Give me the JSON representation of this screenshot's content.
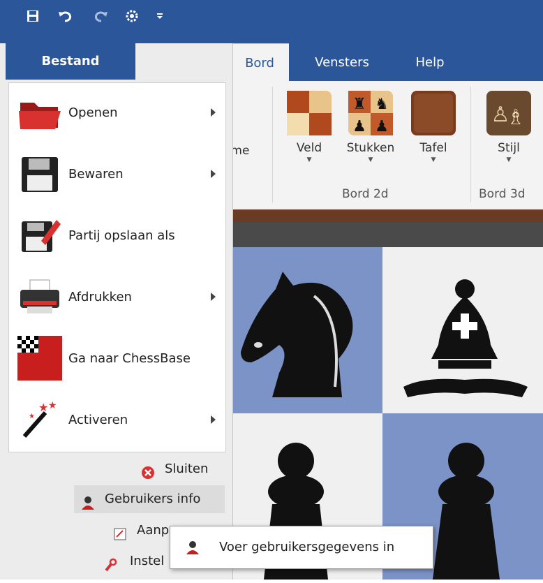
{
  "titlebar": {
    "quick_access": [
      "save-icon",
      "undo-icon",
      "redo-icon",
      "engine-icon",
      "customize-dropdown-icon"
    ]
  },
  "tabs": [
    {
      "label": "Bord",
      "active": true
    },
    {
      "label": "Vensters",
      "active": false
    },
    {
      "label": "Help",
      "active": false
    }
  ],
  "ribbon": {
    "partial_label": "ame",
    "buttons": [
      {
        "label": "Veld",
        "icon": "board-squares-icon"
      },
      {
        "label": "Stukken",
        "icon": "chess-pieces-icon"
      },
      {
        "label": "Tafel",
        "icon": "table-wood-icon"
      },
      {
        "label": "Stijl",
        "icon": "3d-style-icon"
      }
    ],
    "groups": [
      "Bord 2d",
      "Bord 3d"
    ]
  },
  "file_menu": {
    "tab_label": "Bestand",
    "items": [
      {
        "label": "Openen",
        "icon": "folder-open-icon",
        "submenu": true
      },
      {
        "label": "Bewaren",
        "icon": "floppy-disk-icon",
        "submenu": true
      },
      {
        "label": "Partij opslaan als",
        "icon": "save-as-icon",
        "submenu": false
      },
      {
        "label": "Afdrukken",
        "icon": "printer-icon",
        "submenu": true
      },
      {
        "label": "Ga naar ChessBase",
        "icon": "chessbase-logo-icon",
        "submenu": false
      },
      {
        "label": "Activeren",
        "icon": "magic-wand-icon",
        "submenu": true
      }
    ],
    "bottom_items": [
      {
        "label": "Sluiten",
        "icon": "close-circle-icon"
      },
      {
        "label": "Gebruikers info",
        "icon": "user-icon"
      },
      {
        "label": "Aanp",
        "icon": "customize-icon"
      },
      {
        "label": "Instel",
        "icon": "settings-icon"
      }
    ]
  },
  "tooltip": {
    "text": "Voer gebruikersgegevens in",
    "icon": "user-icon"
  },
  "colors": {
    "accent": "#2b579a",
    "board_dark": "#7c93c8",
    "board_light": "#f0f0f0"
  }
}
